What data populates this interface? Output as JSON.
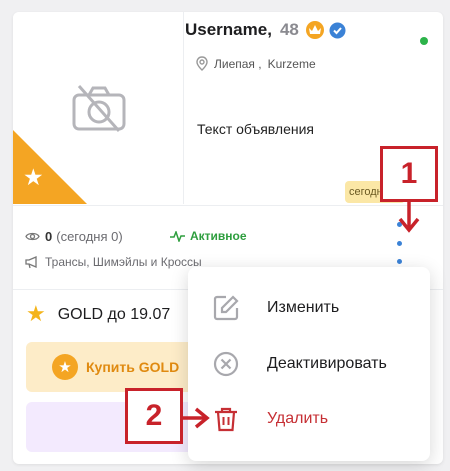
{
  "listing": {
    "username": "Username,",
    "age": "48",
    "vip_badge": "VIP",
    "location_city": "Лиепая ,",
    "location_region": "Kurzeme",
    "description": "Текст объявления",
    "date_badge": "сегодня"
  },
  "stats": {
    "views_count": "0",
    "views_today": "(сегодня 0)",
    "status": "Активное",
    "category": "Трансы, Шимэйлы и Кроссы"
  },
  "gold": {
    "label": "GOLD до 19.07",
    "buy_label": "Купить GOLD"
  },
  "menu": {
    "edit_label": "Изменить",
    "deactivate_label": "Деактивировать",
    "delete_label": "Удалить"
  },
  "callouts": {
    "step1": "1",
    "step2": "2"
  },
  "colors": {
    "accent": "#3b82d6",
    "gold": "#f4a523",
    "active": "#2e9e3e",
    "delete": "#c62f34",
    "callout": "#c8222a"
  },
  "icons": [
    "camera-off-icon",
    "star-icon",
    "vip-crown-icon",
    "verified-icon",
    "location-pin-icon",
    "eye-icon",
    "pulse-icon",
    "megaphone-icon",
    "more-vertical-icon",
    "edit-icon",
    "deactivate-icon",
    "trash-icon",
    "arrow-down-icon",
    "arrow-right-icon"
  ]
}
